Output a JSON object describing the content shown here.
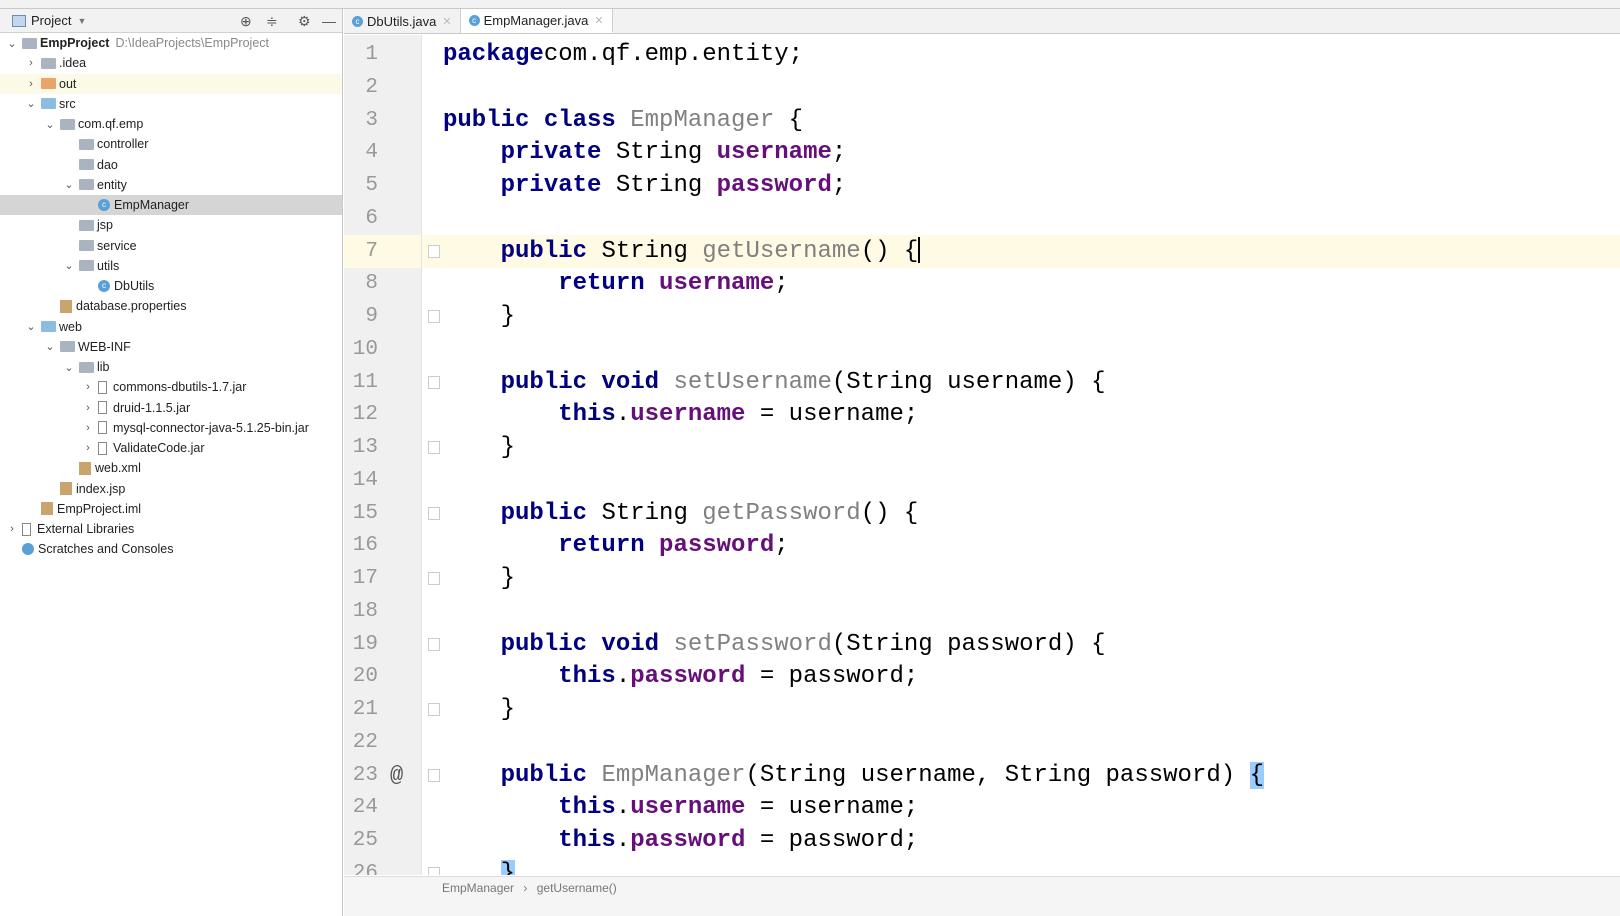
{
  "sidebar": {
    "title": "Project",
    "rows": [
      {
        "label": "EmpProject",
        "path": "D:\\IdeaProjects\\EmpProject",
        "depth": 0,
        "chev": "v",
        "icon": "module"
      },
      {
        "label": ".idea",
        "depth": 1,
        "chev": ">",
        "icon": "folder"
      },
      {
        "label": "out",
        "depth": 1,
        "chev": ">",
        "icon": "folder-orange"
      },
      {
        "label": "src",
        "depth": 1,
        "chev": "v",
        "icon": "folder-blue"
      },
      {
        "label": "com.qf.emp",
        "depth": 2,
        "chev": "v",
        "icon": "package"
      },
      {
        "label": "controller",
        "depth": 3,
        "chev": "",
        "icon": "package"
      },
      {
        "label": "dao",
        "depth": 3,
        "chev": "",
        "icon": "package"
      },
      {
        "label": "entity",
        "depth": 3,
        "chev": "v",
        "icon": "package"
      },
      {
        "label": "EmpManager",
        "depth": 4,
        "chev": "",
        "icon": "class",
        "selected": true
      },
      {
        "label": "jsp",
        "depth": 3,
        "chev": "",
        "icon": "package"
      },
      {
        "label": "service",
        "depth": 3,
        "chev": "",
        "icon": "package"
      },
      {
        "label": "utils",
        "depth": 3,
        "chev": "v",
        "icon": "package"
      },
      {
        "label": "DbUtils",
        "depth": 4,
        "chev": "",
        "icon": "class"
      },
      {
        "label": "database.properties",
        "depth": 2,
        "chev": "",
        "icon": "file"
      },
      {
        "label": "web",
        "depth": 1,
        "chev": "v",
        "icon": "folder-blue"
      },
      {
        "label": "WEB-INF",
        "depth": 2,
        "chev": "v",
        "icon": "folder"
      },
      {
        "label": "lib",
        "depth": 3,
        "chev": "v",
        "icon": "folder"
      },
      {
        "label": "commons-dbutils-1.7.jar",
        "depth": 4,
        "chev": ">",
        "icon": "jar"
      },
      {
        "label": "druid-1.1.5.jar",
        "depth": 4,
        "chev": ">",
        "icon": "jar"
      },
      {
        "label": "mysql-connector-java-5.1.25-bin.jar",
        "depth": 4,
        "chev": ">",
        "icon": "jar"
      },
      {
        "label": "ValidateCode.jar",
        "depth": 4,
        "chev": ">",
        "icon": "jar"
      },
      {
        "label": "web.xml",
        "depth": 3,
        "chev": "",
        "icon": "file"
      },
      {
        "label": "index.jsp",
        "depth": 2,
        "chev": "",
        "icon": "file"
      },
      {
        "label": "EmpProject.iml",
        "depth": 1,
        "chev": "",
        "icon": "file"
      },
      {
        "label": "External Libraries",
        "depth": 0,
        "chev": ">",
        "icon": "library"
      },
      {
        "label": "Scratches and Consoles",
        "depth": 0,
        "chev": "",
        "icon": "scratch"
      }
    ]
  },
  "tabs": [
    {
      "label": "DbUtils.java",
      "active": false
    },
    {
      "label": "EmpManager.java",
      "active": true
    }
  ],
  "editor": {
    "current_line": 7,
    "lines": [
      [
        [
          "kw",
          "package"
        ],
        [
          "",
          "com.qf.emp.entity;"
        ]
      ],
      [],
      [
        [
          "kw",
          "public class "
        ],
        [
          "mth",
          "EmpManager"
        ],
        [
          "",
          " {"
        ]
      ],
      [
        [
          "",
          "    "
        ],
        [
          "kw",
          "private "
        ],
        [
          "",
          "String "
        ],
        [
          "fld",
          "username"
        ],
        [
          "",
          ";"
        ]
      ],
      [
        [
          "",
          "    "
        ],
        [
          "kw",
          "private "
        ],
        [
          "",
          "String "
        ],
        [
          "fld",
          "password"
        ],
        [
          "",
          ";"
        ]
      ],
      [],
      [
        [
          "",
          "    "
        ],
        [
          "kw",
          "public "
        ],
        [
          "",
          "String "
        ],
        [
          "mth",
          "getUsername"
        ],
        [
          "",
          "() {"
        ],
        [
          "caret",
          ""
        ]
      ],
      [
        [
          "",
          "        "
        ],
        [
          "kw",
          "return "
        ],
        [
          "fld",
          "username"
        ],
        [
          "",
          ";"
        ]
      ],
      [
        [
          "",
          "    }"
        ]
      ],
      [],
      [
        [
          "",
          "    "
        ],
        [
          "kw",
          "public void "
        ],
        [
          "mth",
          "setUsername"
        ],
        [
          "",
          "(String username) {"
        ]
      ],
      [
        [
          "",
          "        "
        ],
        [
          "kw",
          "this"
        ],
        [
          "",
          "."
        ],
        [
          "fld",
          "username"
        ],
        [
          "",
          " = username;"
        ]
      ],
      [
        [
          "",
          "    }"
        ]
      ],
      [],
      [
        [
          "",
          "    "
        ],
        [
          "kw",
          "public "
        ],
        [
          "",
          "String "
        ],
        [
          "mth",
          "getPassword"
        ],
        [
          "",
          "() {"
        ]
      ],
      [
        [
          "",
          "        "
        ],
        [
          "kw",
          "return "
        ],
        [
          "fld",
          "password"
        ],
        [
          "",
          ";"
        ]
      ],
      [
        [
          "",
          "    }"
        ]
      ],
      [],
      [
        [
          "",
          "    "
        ],
        [
          "kw",
          "public void "
        ],
        [
          "mth",
          "setPassword"
        ],
        [
          "",
          "(String password) {"
        ]
      ],
      [
        [
          "",
          "        "
        ],
        [
          "kw",
          "this"
        ],
        [
          "",
          "."
        ],
        [
          "fld",
          "password"
        ],
        [
          "",
          " = password;"
        ]
      ],
      [
        [
          "",
          "    }"
        ]
      ],
      [],
      [
        [
          "",
          "    "
        ],
        [
          "kw",
          "public "
        ],
        [
          "mth",
          "EmpManager"
        ],
        [
          "",
          "(String username, String password) "
        ],
        [
          "br",
          "{"
        ]
      ],
      [
        [
          "",
          "        "
        ],
        [
          "kw",
          "this"
        ],
        [
          "",
          "."
        ],
        [
          "fld",
          "username"
        ],
        [
          "",
          " = username;"
        ]
      ],
      [
        [
          "",
          "        "
        ],
        [
          "kw",
          "this"
        ],
        [
          "",
          "."
        ],
        [
          "fld",
          "password"
        ],
        [
          "",
          " = password;"
        ]
      ],
      [
        [
          "",
          "    "
        ],
        [
          "br",
          "}"
        ]
      ]
    ],
    "fold_lines": [
      7,
      9,
      11,
      13,
      15,
      17,
      19,
      21,
      23,
      26
    ],
    "gutter_annotation": {
      "line": 23,
      "symbol": "@"
    }
  },
  "breadcrumb": [
    "EmpManager",
    "getUsername()"
  ],
  "colors": {
    "keyword": "#000080",
    "field": "#660e7a",
    "unused_method": "#808080",
    "current_line": "#fffae3",
    "brace_match": "#99ccff"
  }
}
